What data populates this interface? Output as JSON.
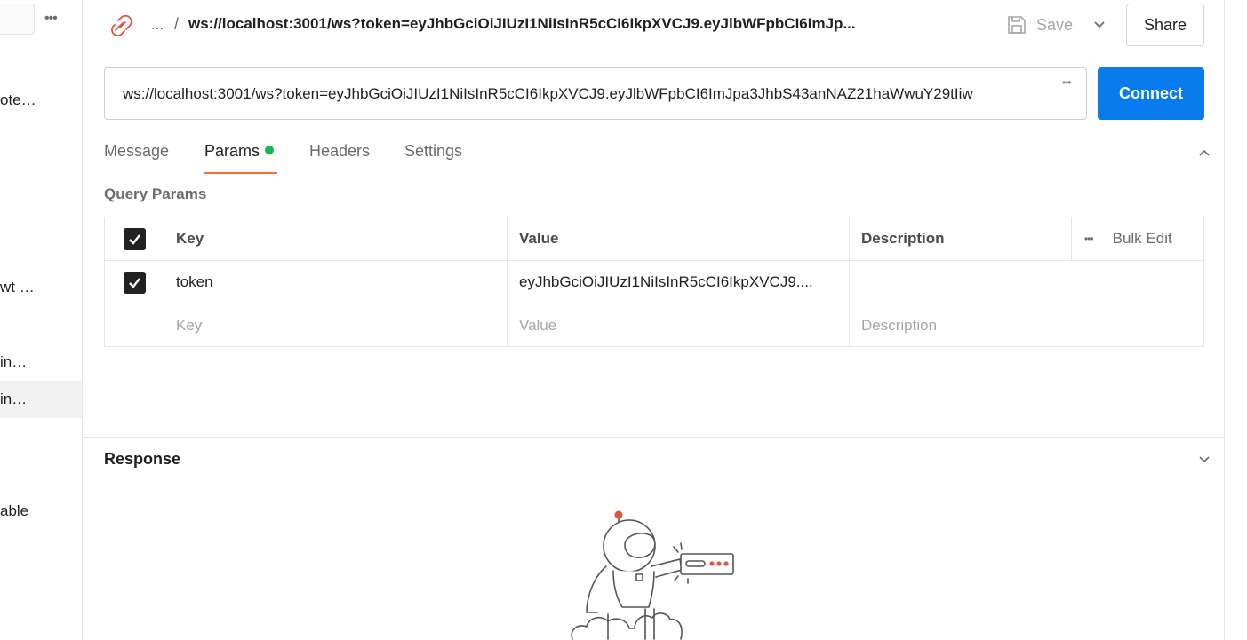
{
  "sidebar": {
    "items": [
      {
        "label": "ote…",
        "top": 0
      },
      {
        "label": "wt …"
      },
      {
        "label": "in…"
      },
      {
        "label": "in…"
      },
      {
        "label": "able"
      }
    ]
  },
  "header": {
    "breadcrumb_ellipsis": "...",
    "breadcrumb_sep": "/",
    "title": "ws://localhost:3001/ws?token=eyJhbGciOiJIUzI1NiIsInR5cCI6IkpXVCJ9.eyJlbWFpbCI6ImJp...",
    "save_label": "Save",
    "share_label": "Share"
  },
  "request": {
    "url": "ws://localhost:3001/ws?token=eyJhbGciOiJIUzI1NiIsInR5cCI6IkpXVCJ9.eyJlbWFpbCI6ImJpa3JhbS43anNAZ21haWwuY29tIiw",
    "connect_label": "Connect"
  },
  "tabs": [
    {
      "label": "Message"
    },
    {
      "label": "Params"
    },
    {
      "label": "Headers"
    },
    {
      "label": "Settings"
    }
  ],
  "params": {
    "title": "Query Params",
    "headers": {
      "key": "Key",
      "value": "Value",
      "description": "Description",
      "bulk_edit": "Bulk Edit"
    },
    "rows": [
      {
        "key": "token",
        "value": "eyJhbGciOiJIUzI1NiIsInR5cCI6IkpXVCJ9....",
        "description": ""
      }
    ],
    "placeholders": {
      "key": "Key",
      "value": "Value",
      "description": "Description"
    }
  },
  "response": {
    "title": "Response"
  },
  "colors": {
    "accent": "#097bed",
    "tab_underline": "#ff6c37",
    "active_dot": "#0cbb52"
  }
}
